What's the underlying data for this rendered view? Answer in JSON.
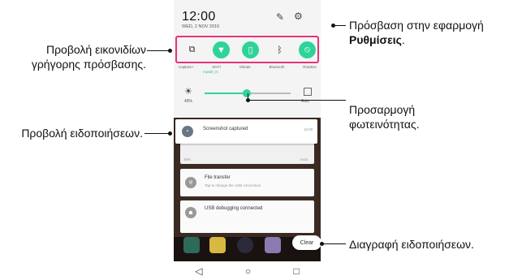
{
  "status": {
    "time": "12:00",
    "date": "WED, 2 NOV 2016"
  },
  "header_icons": [
    "edit-icon",
    "gear-icon"
  ],
  "quick_settings": {
    "labels": [
      "Capture+",
      "Wi-Fi",
      "Vibrate",
      "Bluetooth",
      "Rotation"
    ],
    "wifi_ssid": "mywifi_m"
  },
  "brightness": {
    "percent_label": "49%",
    "level": 0.49,
    "auto_label": "Auto"
  },
  "notifications": [
    {
      "title": "Screenshot captured",
      "time": "12:00"
    },
    {
      "title": "File transfer",
      "subtitle": "Tap to change the USB connection"
    },
    {
      "title": "USB debugging connected"
    }
  ],
  "behind_card": {
    "pct": "49%",
    "auto": "Auto"
  },
  "clear_label": "Clear",
  "annotations": {
    "settings_line1": "Πρόσβαση στην εφαρμογή",
    "settings_line2": "Ρυθμίσεις",
    "settings_period": ".",
    "quick_line1": "Προβολή εικονιδίων",
    "quick_line2": "γρήγορης πρόσβασης.",
    "brightness_line1": "Προσαρμογή",
    "brightness_line2": "φωτεινότητας.",
    "notifications": "Προβολή ειδοποιήσεων.",
    "clear": "Διαγραφή ειδοποιήσεων."
  },
  "colors": {
    "accent": "#2fd39a",
    "highlight": "#e8327a"
  }
}
